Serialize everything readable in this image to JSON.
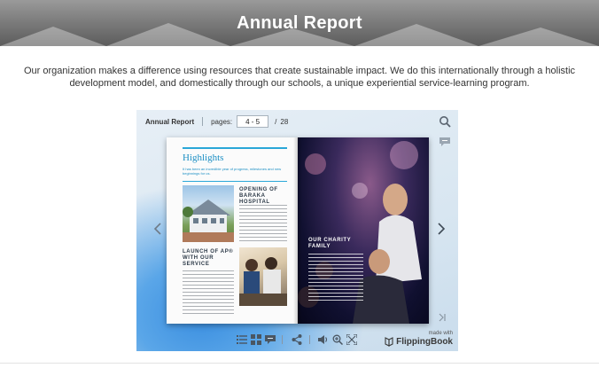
{
  "header": {
    "title": "Annual Report"
  },
  "intro": {
    "text": "Our organization makes a difference using resources that create sustainable impact. We do this internationally through a holistic development model, and domestically through our schools, a unique experiential service-learning program."
  },
  "viewer": {
    "toolbar": {
      "book_title": "Annual Report",
      "pages_label": "pages:",
      "current_pages": "4 - 5",
      "separator": "/",
      "total_pages": "28"
    },
    "left_page": {
      "heading": "Highlights",
      "subheading": "It has been an incredible year of progress, milestones and new beginnings for us.",
      "section1_title": "OPENING OF BARAKA HOSPITAL",
      "section2_title": "LAUNCH OF AP® WITH OUR SERVICE"
    },
    "right_page": {
      "section_title": "OUR CHARITY FAMILY"
    },
    "branding": {
      "made_with": "made with",
      "brand": "FlippingBook"
    }
  }
}
